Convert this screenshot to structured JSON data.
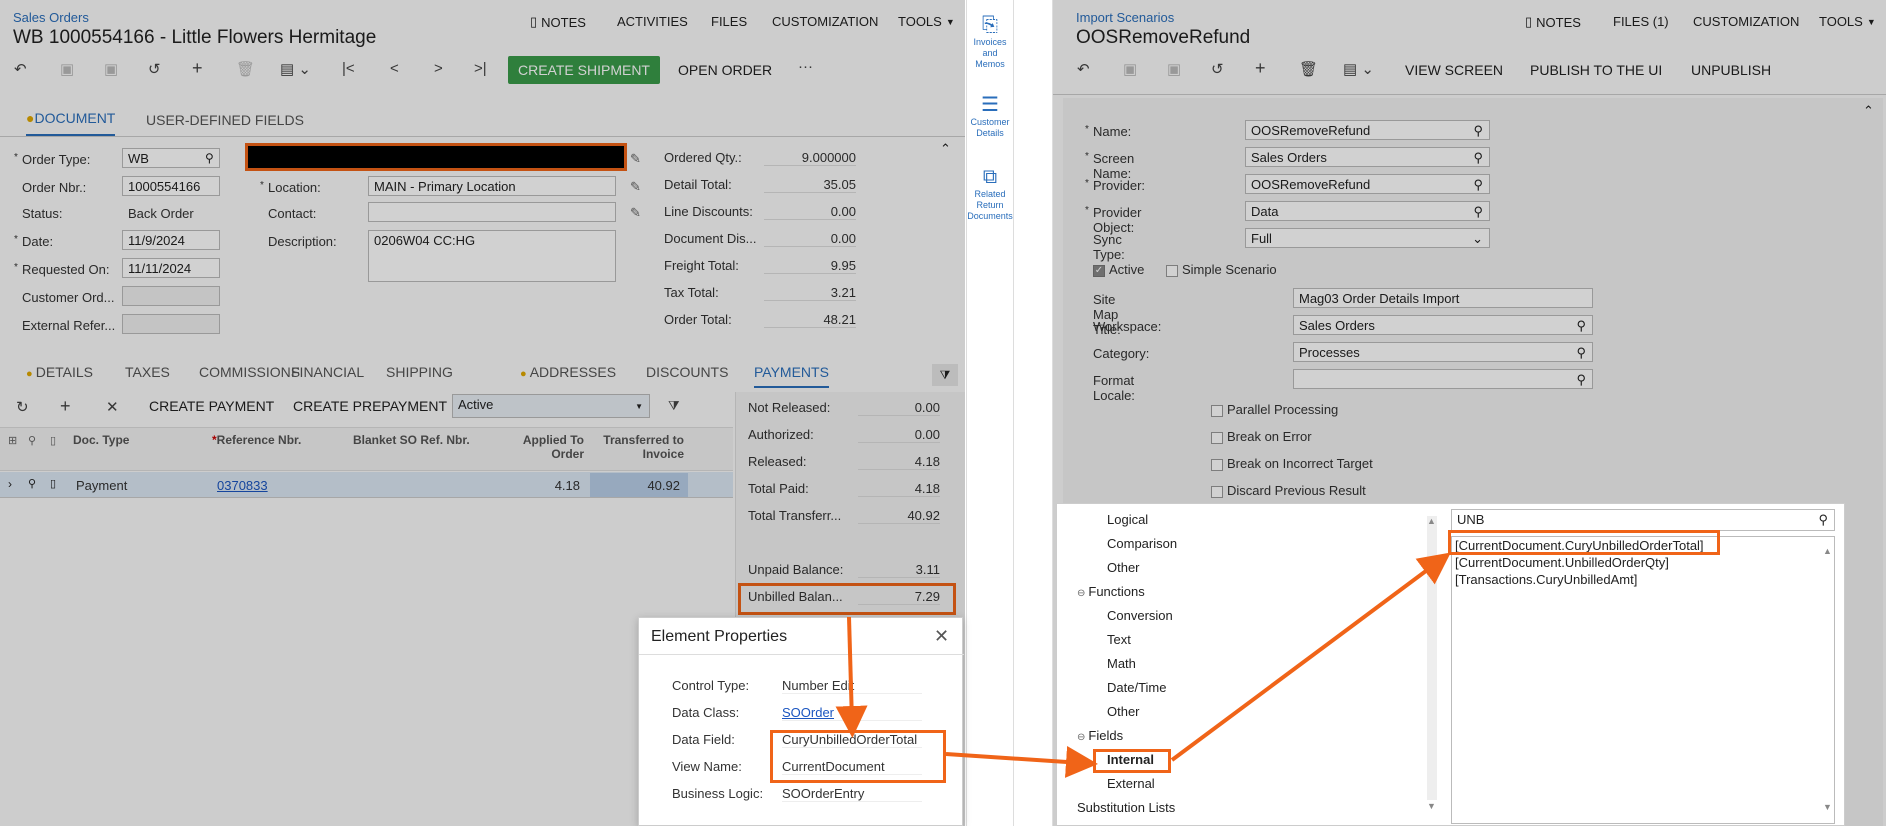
{
  "left": {
    "breadcrumb": "Sales Orders",
    "title": "WB 1000554166 - Little Flowers Hermitage",
    "top_actions": [
      "NOTES",
      "ACTIVITIES",
      "FILES",
      "CUSTOMIZATION",
      "TOOLS"
    ],
    "create_shipment": "CREATE SHIPMENT",
    "open_order": "OPEN ORDER",
    "tabs": [
      "DOCUMENT",
      "USER-DEFINED FIELDS"
    ],
    "fields": {
      "order_type_label": "Order Type:",
      "order_type": "WB",
      "order_nbr_label": "Order Nbr.:",
      "order_nbr": "1000554166",
      "status_label": "Status:",
      "status": "Back Order",
      "date_label": "Date:",
      "date": "11/9/2024",
      "requested_label": "Requested On:",
      "requested": "11/11/2024",
      "customer_ord_label": "Customer Ord...",
      "external_ref_label": "External Refer...",
      "location_label": "Location:",
      "location": "MAIN - Primary Location",
      "contact_label": "Contact:",
      "description_label": "Description:",
      "description": "0206W04 CC:HG"
    },
    "totals": [
      {
        "label": "Ordered Qty.:",
        "value": "9.000000"
      },
      {
        "label": "Detail Total:",
        "value": "35.05"
      },
      {
        "label": "Line Discounts:",
        "value": "0.00"
      },
      {
        "label": "Document Dis...",
        "value": "0.00"
      },
      {
        "label": "Freight Total:",
        "value": "9.95"
      },
      {
        "label": "Tax Total:",
        "value": "3.21"
      },
      {
        "label": "Order Total:",
        "value": "48.21"
      }
    ],
    "subtabs": [
      "DETAILS",
      "TAXES",
      "COMMISSIONS",
      "FINANCIAL",
      "SHIPPING",
      "ADDRESSES",
      "DISCOUNTS",
      "PAYMENTS"
    ],
    "grid_toolbar": {
      "create_payment": "CREATE PAYMENT",
      "create_prepayment": "CREATE PREPAYMENT",
      "filter": "Active"
    },
    "grid_headers": [
      "Doc. Type",
      "Reference Nbr.",
      "Blanket SO Ref. Nbr.",
      "Applied To Order",
      "Transferred to Invoice"
    ],
    "grid_row": {
      "doc_type": "Payment",
      "ref": "0370833",
      "applied": "4.18",
      "transferred": "40.92"
    },
    "payments": [
      {
        "label": "Not Released:",
        "value": "0.00"
      },
      {
        "label": "Authorized:",
        "value": "0.00"
      },
      {
        "label": "Released:",
        "value": "4.18"
      },
      {
        "label": "Total Paid:",
        "value": "4.18"
      },
      {
        "label": "Total Transferr...",
        "value": "40.92"
      },
      {
        "label": "Unpaid Balance:",
        "value": "3.11"
      },
      {
        "label": "Unbilled Balan...",
        "value": "7.29"
      }
    ]
  },
  "mid": {
    "items": [
      {
        "l1": "Invoices and",
        "l2": "Memos"
      },
      {
        "l1": "Customer",
        "l2": "Details"
      },
      {
        "l1": "Related",
        "l2": "Return",
        "l3": "Documents"
      }
    ]
  },
  "props": {
    "title": "Element Properties",
    "rows": [
      {
        "label": "Control Type:",
        "value": "Number Edit"
      },
      {
        "label": "Data Class:",
        "value": "SOOrder"
      },
      {
        "label": "Data Field:",
        "value": "CuryUnbilledOrderTotal"
      },
      {
        "label": "View Name:",
        "value": "CurrentDocument"
      },
      {
        "label": "Business Logic:",
        "value": "SOOrderEntry"
      }
    ]
  },
  "right": {
    "breadcrumb": "Import Scenarios",
    "title": "OOSRemoveRefund",
    "top_actions": [
      "NOTES",
      "FILES (1)",
      "CUSTOMIZATION",
      "TOOLS"
    ],
    "actions": [
      "VIEW SCREEN",
      "PUBLISH TO THE UI",
      "UNPUBLISH"
    ],
    "fields": [
      {
        "label": "Name:",
        "value": "OOSRemoveRefund"
      },
      {
        "label": "Screen Name:",
        "value": "Sales Orders"
      },
      {
        "label": "Provider:",
        "value": "OOSRemoveRefund"
      },
      {
        "label": "Provider Object:",
        "value": "Data"
      },
      {
        "label": "Sync Type:",
        "value": "Full"
      }
    ],
    "active": "Active",
    "simple": "Simple Scenario",
    "fields2": [
      {
        "label": "Site Map Title:",
        "value": "Mag03 Order Details Import"
      },
      {
        "label": "Workspace:",
        "value": "Sales Orders"
      },
      {
        "label": "Category:",
        "value": "Processes"
      },
      {
        "label": "Format Locale:",
        "value": ""
      }
    ],
    "checks": [
      "Parallel Processing",
      "Break on Error",
      "Break on Incorrect Target",
      "Discard Previous Result"
    ],
    "tree": [
      "Logical",
      "Comparison",
      "Other",
      "Functions",
      "Conversion",
      "Text",
      "Math",
      "Date/Time",
      "Other",
      "Fields",
      "Internal",
      "External",
      "Substitution Lists"
    ],
    "search": "UNB",
    "results": [
      "[CurrentDocument.CuryUnbilledOrderTotal]",
      "[CurrentDocument.UnbilledOrderQty]",
      "[Transactions.CuryUnbilledAmt]"
    ]
  }
}
